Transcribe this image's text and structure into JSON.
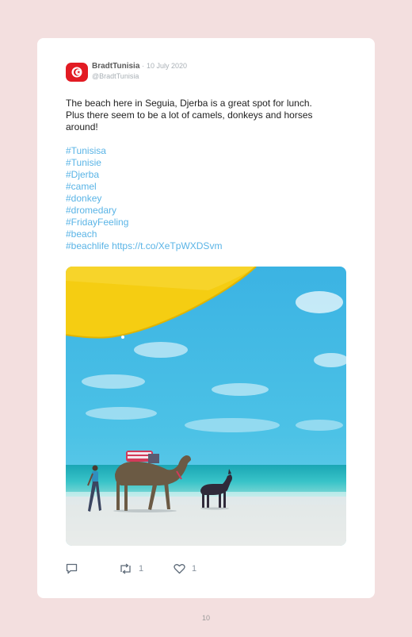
{
  "tweet": {
    "author_name": "BradtTunisia",
    "separator": "·",
    "date": "10 July 2020",
    "handle": "@BradtTunisia",
    "text_lines": [
      "The beach here in Seguia, Djerba is a great spot for lunch.",
      "Plus there seem to be a lot of camels, donkeys and horses",
      "around!"
    ],
    "hashtags": [
      "#Tunisisa",
      "#Tunisie",
      "#Djerba",
      "#camel",
      "#donkey",
      "#dromedary",
      "#FridayFeeling",
      "#beach"
    ],
    "last_hashtag": "#beachlife",
    "link": "https://t.co/XeTpWXDSvm",
    "retweet_count": "1",
    "like_count": "1"
  },
  "page_number": "10",
  "colors": {
    "page_background": "#f3dfdf",
    "hashtag_link": "#5ab4e6",
    "flag_red": "#e21b23"
  },
  "icons": {
    "avatar": "tunisia-flag",
    "reply": "reply-icon",
    "retweet": "retweet-icon",
    "like": "heart-icon"
  }
}
